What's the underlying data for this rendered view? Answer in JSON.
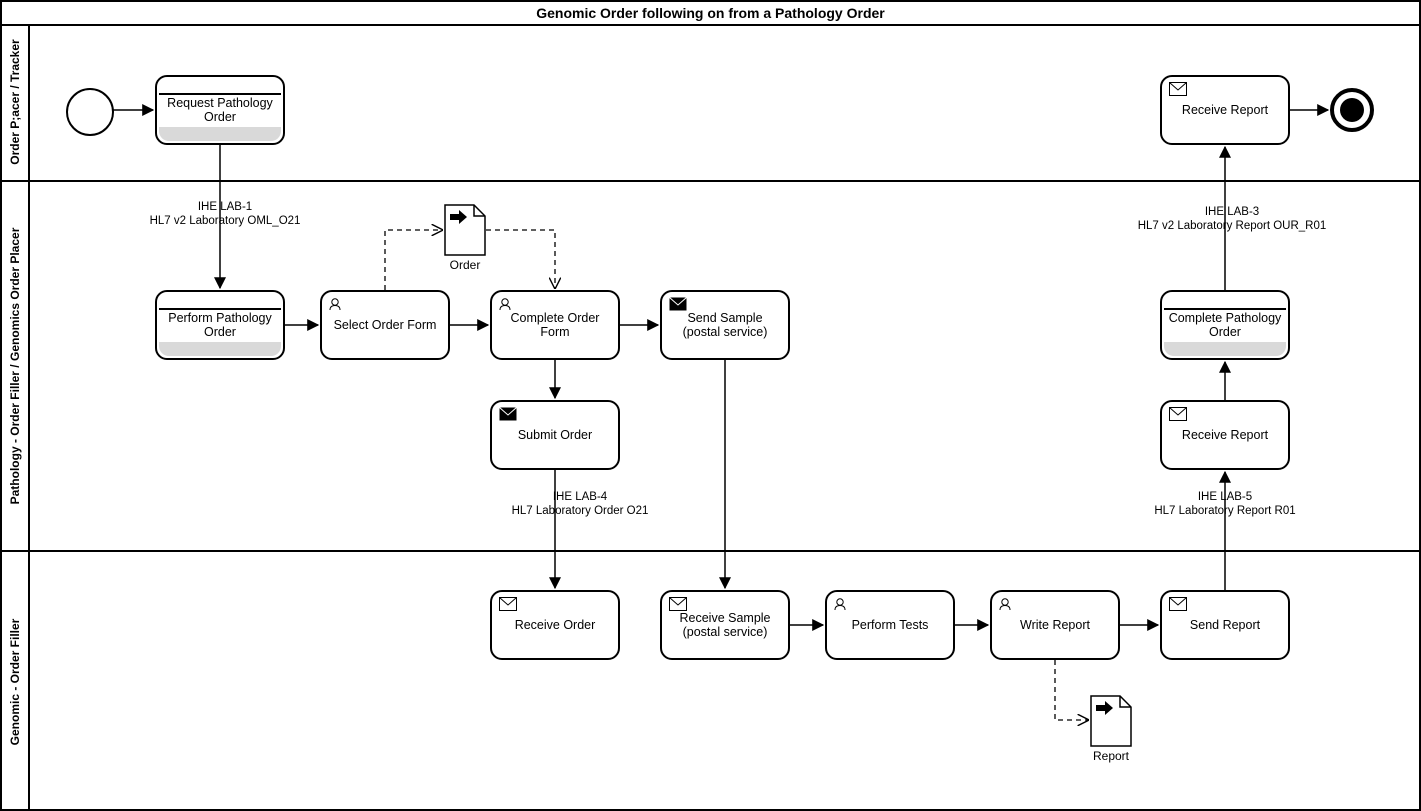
{
  "chart_data": {
    "type": "bpmn",
    "pool_title": "Genomic Order following on from a Pathology Order",
    "lanes": [
      {
        "id": "lane1",
        "label": "Order P;acer / Tracker"
      },
      {
        "id": "lane2",
        "label": "Pathology - Order Filler / Genomics Order Placer"
      },
      {
        "id": "lane3",
        "label": "Genomic - Order Filler"
      }
    ],
    "tasks": {
      "request_pathology_order": {
        "label": "Request Pathology\nOrder",
        "lane": "lane1",
        "type": "collapsed-subprocess"
      },
      "receive_report_top": {
        "label": "Receive Report",
        "lane": "lane1",
        "type": "receive-task"
      },
      "perform_pathology_order": {
        "label": "Perform Pathology\nOrder",
        "lane": "lane2",
        "type": "collapsed-subprocess"
      },
      "select_order_form": {
        "label": "Select Order Form",
        "lane": "lane2",
        "type": "user-task"
      },
      "complete_order_form": {
        "label": "Complete  Order\nForm",
        "lane": "lane2",
        "type": "user-task"
      },
      "send_sample": {
        "label": "Send Sample\n(postal service)",
        "lane": "lane2",
        "type": "send-task"
      },
      "submit_order": {
        "label": "Submit Order",
        "lane": "lane2",
        "type": "send-task"
      },
      "receive_report_mid": {
        "label": "Receive Report",
        "lane": "lane2",
        "type": "receive-task"
      },
      "complete_pathology_order": {
        "label": "Complete Pathology\nOrder",
        "lane": "lane2",
        "type": "collapsed-subprocess"
      },
      "receive_order": {
        "label": "Receive Order",
        "lane": "lane3",
        "type": "receive-task"
      },
      "receive_sample": {
        "label": "Receive  Sample\n(postal service)",
        "lane": "lane3",
        "type": "receive-task"
      },
      "perform_tests": {
        "label": "Perform Tests",
        "lane": "lane3",
        "type": "user-task"
      },
      "write_report": {
        "label": "Write Report",
        "lane": "lane3",
        "type": "user-task"
      },
      "send_report": {
        "label": "Send Report",
        "lane": "lane3",
        "type": "send-task"
      }
    },
    "events": {
      "start": {
        "type": "start",
        "lane": "lane1"
      },
      "end": {
        "type": "end",
        "lane": "lane1"
      }
    },
    "data_objects": {
      "order": {
        "label": "Order",
        "lane": "lane2"
      },
      "report": {
        "label": "Report",
        "lane": "lane3"
      }
    },
    "sequence_flows": [
      {
        "from": "start",
        "to": "request_pathology_order"
      },
      {
        "from": "request_pathology_order",
        "to": "perform_pathology_order",
        "label": "IHE LAB-1\nHL7 v2 Laboratory OML_O21"
      },
      {
        "from": "perform_pathology_order",
        "to": "select_order_form"
      },
      {
        "from": "select_order_form",
        "to": "complete_order_form"
      },
      {
        "from": "complete_order_form",
        "to": "send_sample"
      },
      {
        "from": "complete_order_form",
        "to": "submit_order"
      },
      {
        "from": "submit_order",
        "to": "receive_order",
        "label": "IHE LAB-4\nHL7 Laboratory Order O21"
      },
      {
        "from": "send_sample",
        "to": "receive_sample"
      },
      {
        "from": "receive_sample",
        "to": "perform_tests"
      },
      {
        "from": "perform_tests",
        "to": "write_report"
      },
      {
        "from": "write_report",
        "to": "send_report"
      },
      {
        "from": "send_report",
        "to": "receive_report_mid",
        "label": "IHE LAB-5\nHL7 Laboratory Report R01"
      },
      {
        "from": "receive_report_mid",
        "to": "complete_pathology_order"
      },
      {
        "from": "complete_pathology_order",
        "to": "receive_report_top",
        "label": "IHE LAB-3\nHL7 v2 Laboratory Report OUR_R01"
      },
      {
        "from": "receive_report_top",
        "to": "end"
      }
    ],
    "data_associations": [
      {
        "from": "select_order_form",
        "to": "order"
      },
      {
        "from": "order",
        "to": "complete_order_form"
      },
      {
        "from": "write_report",
        "to": "report"
      }
    ]
  }
}
